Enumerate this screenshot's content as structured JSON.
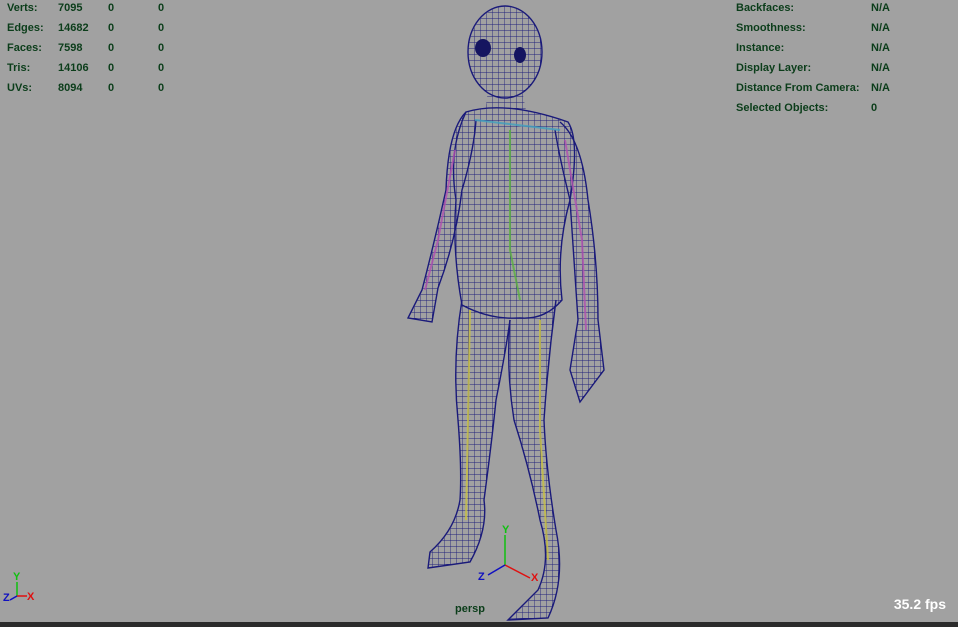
{
  "stats": [
    {
      "label": "Verts:",
      "values": [
        "7095",
        "0",
        "0"
      ]
    },
    {
      "label": "Edges:",
      "values": [
        "14682",
        "0",
        "0"
      ]
    },
    {
      "label": "Faces:",
      "values": [
        "7598",
        "0",
        "0"
      ]
    },
    {
      "label": "Tris:",
      "values": [
        "14106",
        "0",
        "0"
      ]
    },
    {
      "label": "UVs:",
      "values": [
        "8094",
        "0",
        "0"
      ]
    }
  ],
  "object_info": [
    {
      "label": "Backfaces:",
      "value": "N/A"
    },
    {
      "label": "Smoothness:",
      "value": "N/A"
    },
    {
      "label": "Instance:",
      "value": "N/A"
    },
    {
      "label": "Display Layer:",
      "value": "N/A"
    },
    {
      "label": "Distance From Camera:",
      "value": "N/A"
    },
    {
      "label": "Selected Objects:",
      "value": "0"
    }
  ],
  "camera": "persp",
  "fps": "35.2 fps",
  "axis_labels": {
    "x": "X",
    "y": "Y",
    "z": "Z"
  },
  "colors": {
    "background": "#a1a1a1",
    "hud_text": "#0b3d1a",
    "wireframe": "#1a1a7a",
    "axis_x": "#e01010",
    "axis_y": "#10c010",
    "axis_z": "#1010c0"
  }
}
